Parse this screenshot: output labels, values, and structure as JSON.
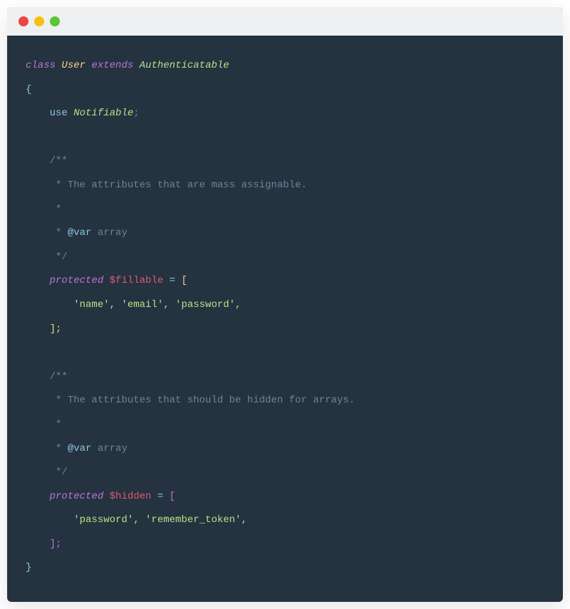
{
  "colors": {
    "titlebar": "#eff0f2",
    "background": "#25323f",
    "dot_red": "#ec4544",
    "dot_yellow": "#f8be10",
    "dot_green": "#5cc43a"
  },
  "code": {
    "kw_class": "class",
    "class_name": "User",
    "kw_extends": "extends",
    "parent_class": "Authenticatable",
    "brace_open": "{",
    "brace_close": "}",
    "kw_use": "use",
    "trait_name": "Notifiable",
    "semicolon": ";",
    "doc_open": "/**",
    "doc_star": " *",
    "doc_close": " */",
    "doc_fillable": " * The attributes that are mass assignable.",
    "doc_hidden": " * The attributes that should be hidden for arrays.",
    "doc_var_tag": "@var",
    "doc_var_type": "array",
    "kw_protected": "protected",
    "var_fillable": "$fillable",
    "var_hidden": "$hidden",
    "equals": "=",
    "bracket_open": "[",
    "bracket_close_semi": "];",
    "fillable_items": "'name', 'email', 'password',",
    "hidden_items": "'password', 'remember_token',"
  }
}
